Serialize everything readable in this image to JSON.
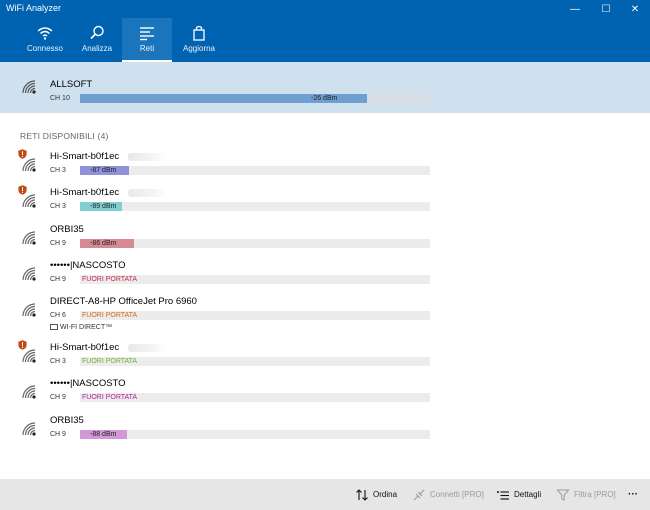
{
  "app": {
    "title": "WiFi Analyzer"
  },
  "window_controls": {
    "minimize": "—",
    "maximize": "☐",
    "close": "✕"
  },
  "tabs": [
    {
      "label": "Connesso",
      "icon": "wifi-icon"
    },
    {
      "label": "Analizza",
      "icon": "search-icon"
    },
    {
      "label": "Reti",
      "icon": "list-icon"
    },
    {
      "label": "Aggiorna",
      "icon": "shopping-bag-icon"
    }
  ],
  "connected": {
    "name": "ALLSOFT",
    "channel": "CH 10",
    "signal": "-26 dBm",
    "level": 0.82,
    "color": "#6f9fd0"
  },
  "section_title": "RETI DISPONIBILI (4)",
  "networks": [
    {
      "name": "Hi-Smart-b0f1ec",
      "channel": "CH 3",
      "signal": "-87 dBm",
      "level": 0.14,
      "color": "#8e92d8",
      "warning": true
    },
    {
      "name": "Hi-Smart-b0f1ec",
      "channel": "CH 3",
      "signal": "-89 dBm",
      "level": 0.12,
      "color": "#7fd0d0",
      "warning": true
    },
    {
      "name": "ORBI35",
      "channel": "CH 9",
      "signal": "-86 dBm",
      "level": 0.155,
      "color": "#d88a94",
      "warning": false
    },
    {
      "name": "••••••|NASCOSTO",
      "channel": "CH 9",
      "status": "FUORI PORTATA",
      "status_color": "#c0284a"
    },
    {
      "name": "DIRECT-A8-HP OfficeJet Pro 6960",
      "channel": "CH 6",
      "status": "FUORI PORTATA",
      "status_color": "#d06a10",
      "extra": "WI-FI DIRECT™"
    },
    {
      "name": "Hi-Smart-b0f1ec",
      "channel": "CH 3",
      "status": "FUORI PORTATA",
      "status_color": "#6ab02a",
      "warning": true
    },
    {
      "name": "••••••|NASCOSTO",
      "channel": "CH 9",
      "status": "FUORI PORTATA",
      "status_color": "#b020a0"
    },
    {
      "name": "ORBI35",
      "channel": "CH 9",
      "signal": "-88 dBm",
      "level": 0.135,
      "color": "#d398d8",
      "warning": false
    }
  ],
  "commands": {
    "sort": "Ordina",
    "connect": "Connetti [PRO]",
    "details": "Dettagli",
    "filter": "Filtra [PRO]",
    "more": "···"
  }
}
